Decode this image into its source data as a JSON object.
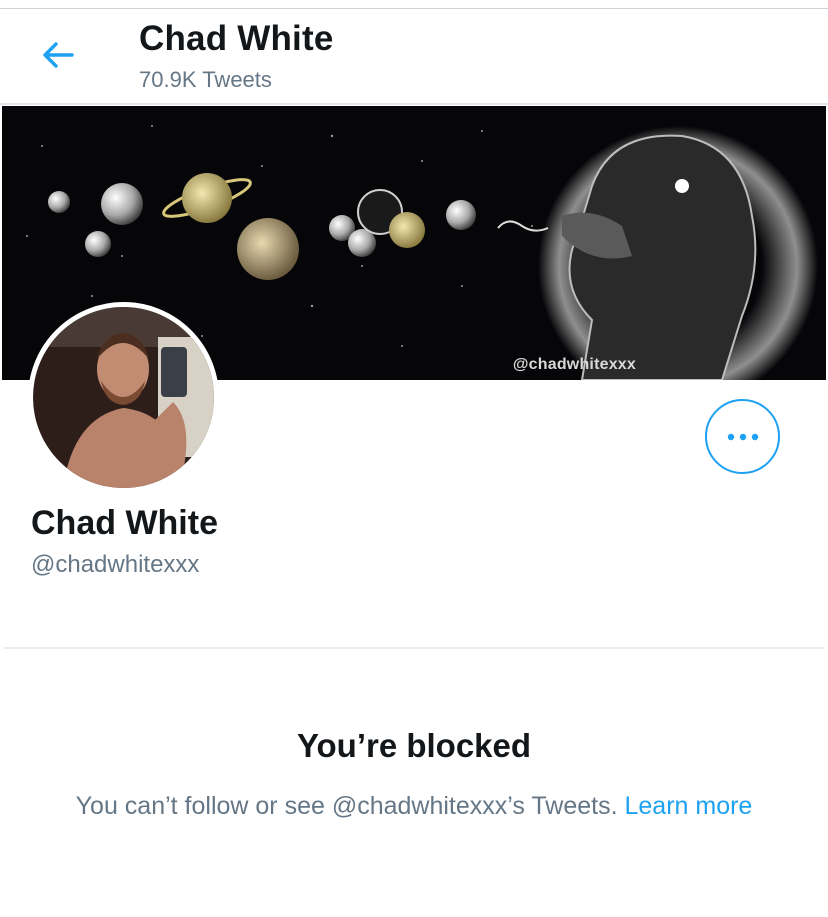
{
  "header": {
    "title": "Chad White",
    "tweet_count": "70.9K Tweets"
  },
  "banner": {
    "watermark": "@chadwhitexxx"
  },
  "profile": {
    "name": "Chad White",
    "handle": "@chadwhitexxx"
  },
  "blocked": {
    "title": "You’re blocked",
    "message": "You can’t follow or see @chadwhitexxx’s Tweets.",
    "learn_more": "Learn more"
  },
  "colors": {
    "accent": "#1da1f2",
    "secondary_text": "#657786",
    "primary_text": "#14171a"
  },
  "icons": {
    "back": "arrow-left-icon",
    "more": "more-horizontal-icon"
  }
}
